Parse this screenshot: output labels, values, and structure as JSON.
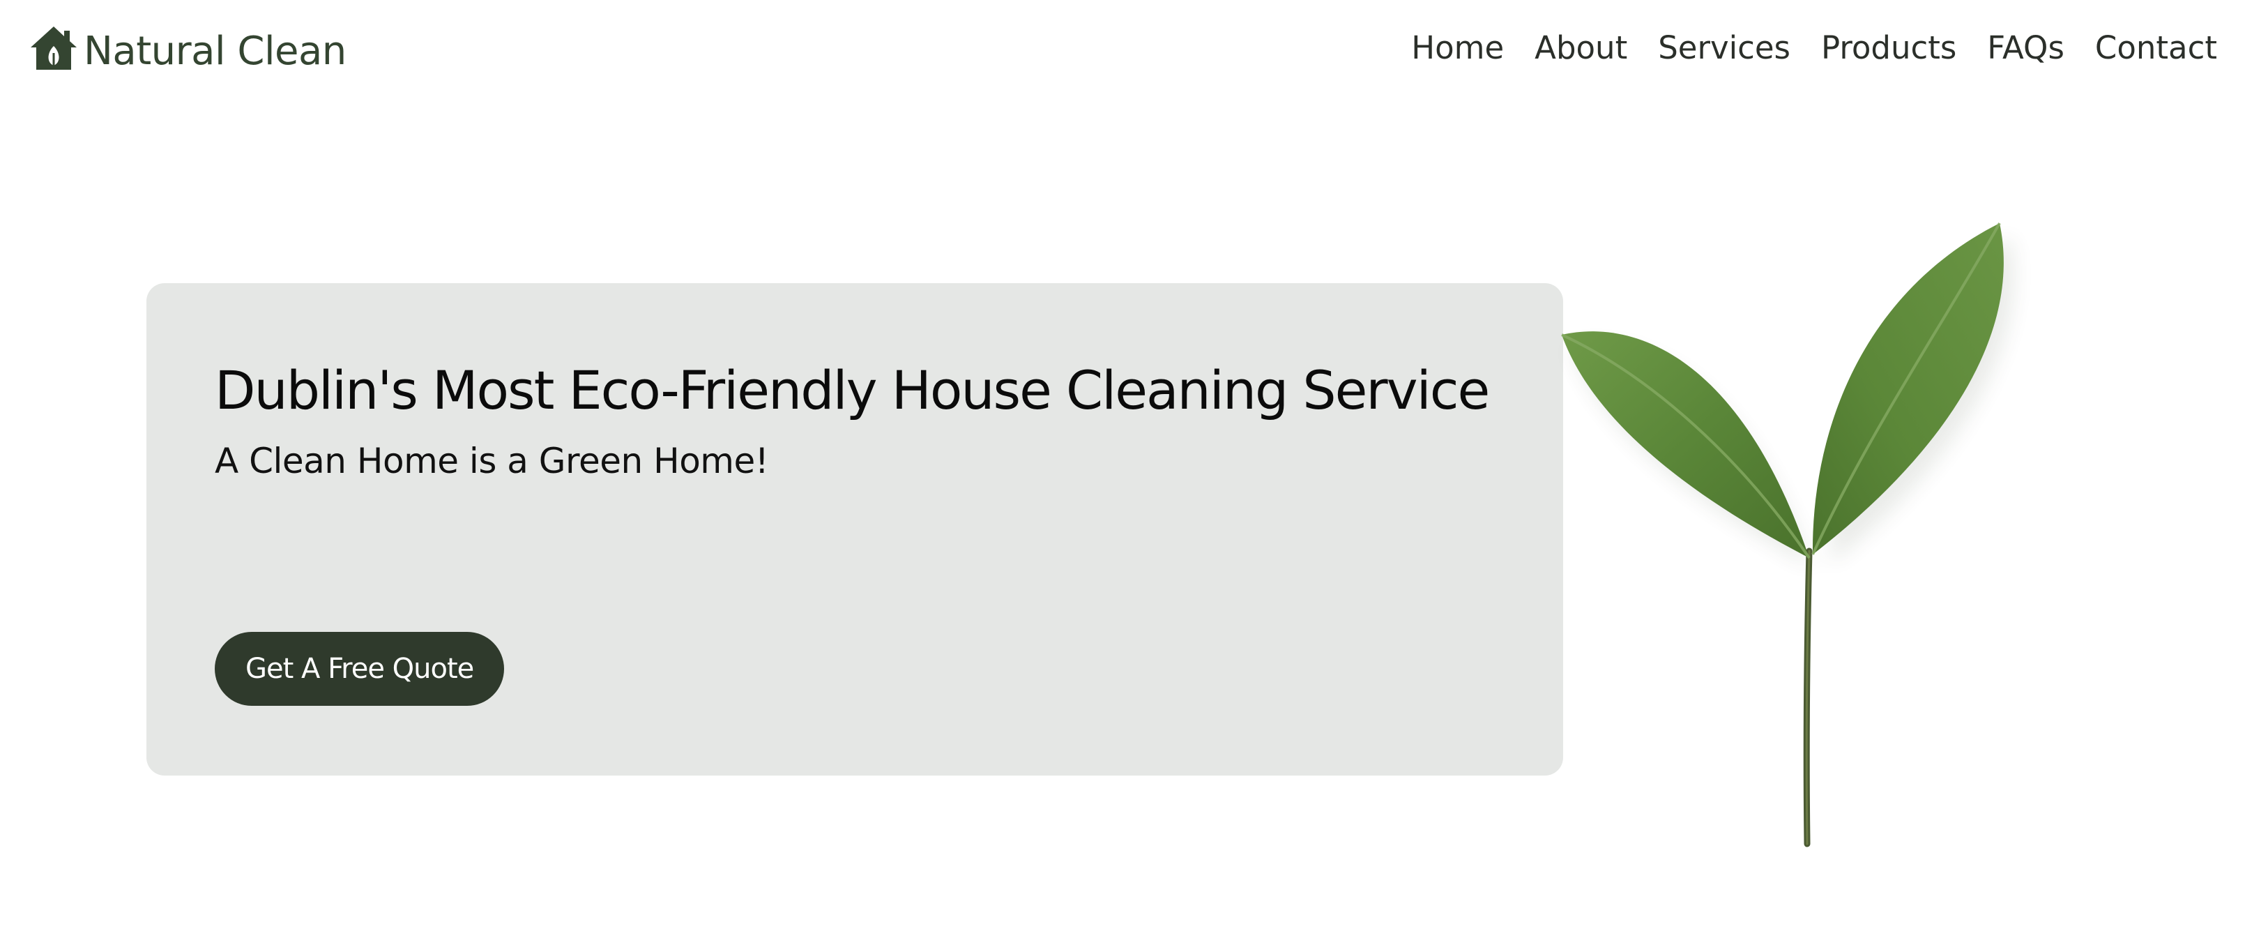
{
  "brand": {
    "name": "Natural Clean",
    "icon": "house-leaf-icon",
    "color": "#344531"
  },
  "nav": {
    "items": [
      {
        "label": "Home"
      },
      {
        "label": "About"
      },
      {
        "label": "Services"
      },
      {
        "label": "Products"
      },
      {
        "label": "FAQs"
      },
      {
        "label": "Contact"
      }
    ]
  },
  "hero": {
    "title": "Dublin's Most Eco-Friendly House Cleaning Service",
    "subtitle": "A Clean Home is a Green Home!",
    "cta_label": "Get A Free Quote",
    "card_color": "#e5e7e5",
    "cta_color": "#2f3a2c"
  },
  "illustration": {
    "icon": "leaf-sprout-icon",
    "leaf_color": "#5d8a3c"
  }
}
